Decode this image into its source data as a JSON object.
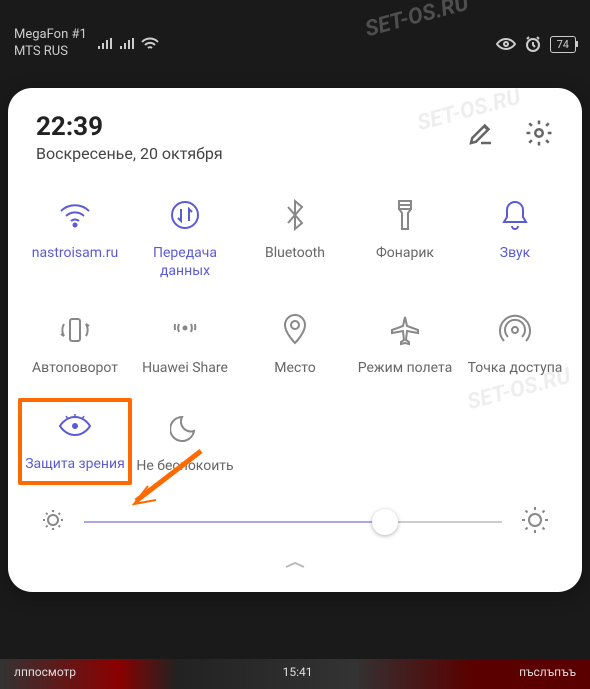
{
  "status_bar": {
    "carrier1": "MegaFon #1",
    "carrier2": "MTS RUS",
    "battery": "74"
  },
  "header": {
    "time": "22:39",
    "date": "Воскресенье, 20 октября"
  },
  "tiles": [
    {
      "label": "nastroisam.ru",
      "icon": "wifi-icon",
      "active": true
    },
    {
      "label": "Передача данных",
      "icon": "data-icon",
      "active": true
    },
    {
      "label": "Bluetooth",
      "icon": "bluetooth-icon",
      "active": false
    },
    {
      "label": "Фонарик",
      "icon": "flashlight-icon",
      "active": false
    },
    {
      "label": "Звук",
      "icon": "sound-icon",
      "active": true
    },
    {
      "label": "Автоповорот",
      "icon": "autorotate-icon",
      "active": false
    },
    {
      "label": "Huawei Share",
      "icon": "share-icon",
      "active": false
    },
    {
      "label": "Место",
      "icon": "location-icon",
      "active": false
    },
    {
      "label": "Режим полета",
      "icon": "airplane-icon",
      "active": false
    },
    {
      "label": "Точка доступа",
      "icon": "hotspot-icon",
      "active": false
    },
    {
      "label": "Защита зрения",
      "icon": "eye-icon",
      "active": true,
      "highlighted": true
    },
    {
      "label": "Не беспокоить",
      "icon": "dnd-icon",
      "active": false
    }
  ],
  "brightness": {
    "percent": 72
  },
  "colors": {
    "accent": "#5b5bd6",
    "highlight": "#ff6a00"
  },
  "watermark": "SET-OS.RU"
}
